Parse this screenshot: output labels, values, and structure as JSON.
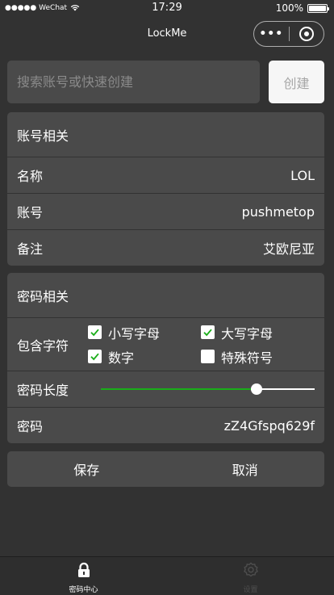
{
  "status_bar": {
    "carrier": "●●●●● WeChat",
    "time": "17:29",
    "battery": "100%"
  },
  "nav": {
    "title": "LockMe",
    "more": "•••"
  },
  "search": {
    "placeholder": "搜索账号或快速创建",
    "value": "",
    "create_label": "创建"
  },
  "account": {
    "header": "账号相关",
    "rows": [
      {
        "label": "名称",
        "value": "LOL"
      },
      {
        "label": "账号",
        "value": "pushmetop"
      },
      {
        "label": "备注",
        "value": "艾欧尼亚"
      }
    ]
  },
  "password": {
    "header": "密码相关",
    "charset_label": "包含字符",
    "options": [
      {
        "label": "小写字母",
        "checked": true
      },
      {
        "label": "大写字母",
        "checked": true
      },
      {
        "label": "数字",
        "checked": true
      },
      {
        "label": "特殊符号",
        "checked": false
      }
    ],
    "length_label": "密码长度",
    "length_level": 0.73,
    "password_label": "密码",
    "password_value": "zZ4Gfspq629f"
  },
  "actions": {
    "save": "保存",
    "cancel": "取消"
  },
  "tabs": [
    {
      "label": "密码中心",
      "icon": "lock-icon",
      "active": true
    },
    {
      "label": "设置",
      "icon": "gear-icon",
      "active": false
    }
  ],
  "colors": {
    "accent": "#1aad19",
    "background": "#323232",
    "card": "#4a4a4a"
  }
}
